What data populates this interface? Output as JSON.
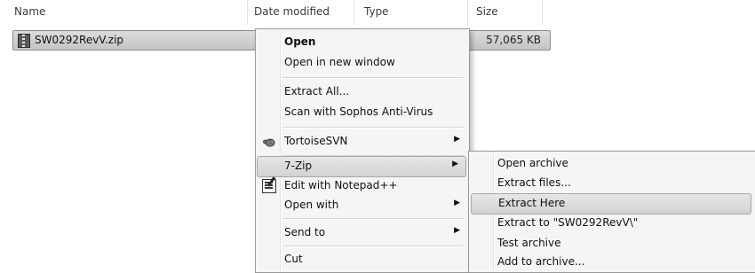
{
  "columns": {
    "name": "Name",
    "date_modified": "Date modified",
    "type": "Type",
    "size": "Size"
  },
  "file": {
    "name": "SW0292RevV.zip",
    "size": "57,065 KB",
    "icon": "zip-archive-icon"
  },
  "context_menu": {
    "open": "Open",
    "open_new_window": "Open in new window",
    "extract_all": "Extract All...",
    "scan": "Scan with Sophos Anti-Virus",
    "tortoise": "TortoiseSVN",
    "sevenzip": "7-Zip",
    "notepad": "Edit with Notepad++",
    "open_with": "Open with",
    "send_to": "Send to",
    "cut": "Cut",
    "submenu_arrow": "▶"
  },
  "sevenzip_submenu": {
    "open_archive": "Open archive",
    "extract_files": "Extract files...",
    "extract_here": "Extract Here",
    "extract_to": "Extract to \"SW0292RevV\\\"",
    "test_archive": "Test archive",
    "add_to_archive": "Add to archive..."
  }
}
